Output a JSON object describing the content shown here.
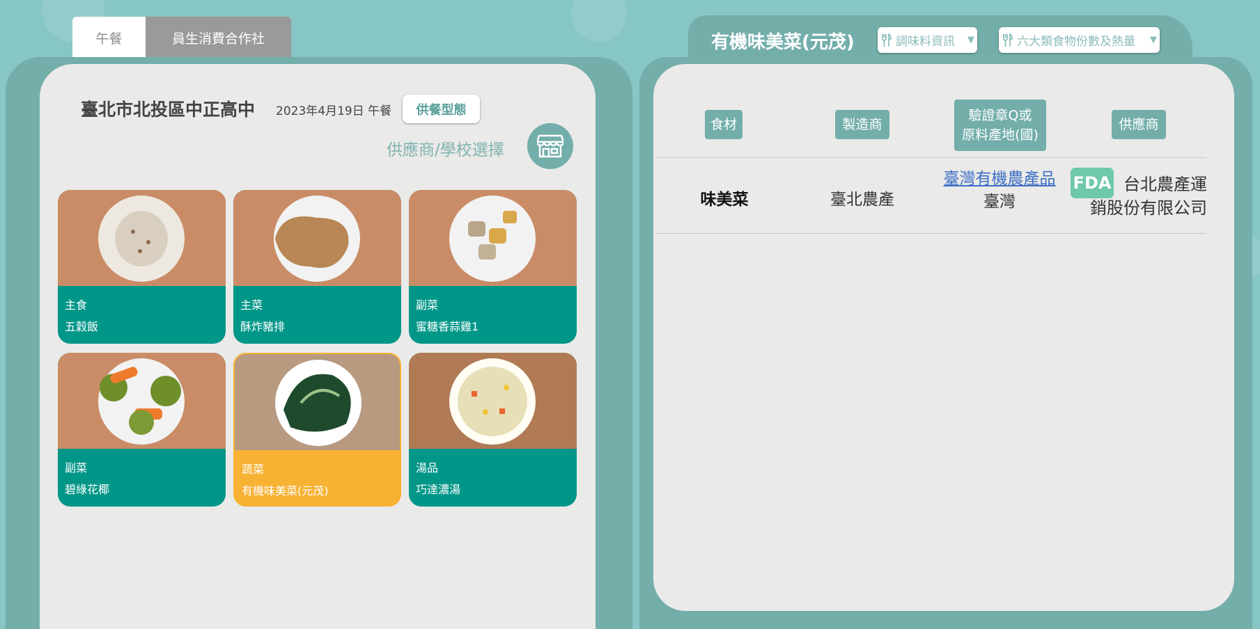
{
  "tabs": {
    "lunch": "午餐",
    "coop": "員生消費合作社"
  },
  "school": {
    "name": "臺北市北投區中正高中",
    "date_meal": "2023年4月19日 午餐",
    "supply_button": "供餐型態",
    "chooser_label": "供應商/學校選擇",
    "chooser_icon": "store-icon"
  },
  "dishes": [
    {
      "category": "主食",
      "name": "五穀飯",
      "plate": "rice",
      "selected": false
    },
    {
      "category": "主菜",
      "name": "酥炸豬排",
      "plate": "pork",
      "selected": false
    },
    {
      "category": "副菜",
      "name": "蜜糖香蒜雞1",
      "plate": "chicken",
      "selected": false
    },
    {
      "category": "副菜",
      "name": "碧綠花椰",
      "plate": "broccoli",
      "selected": false
    },
    {
      "category": "蔬菜",
      "name": "有機味美菜(元茂)",
      "plate": "greens",
      "selected": true
    },
    {
      "category": "湯品",
      "name": "巧達濃湯",
      "plate": "soup",
      "selected": false
    }
  ],
  "detail": {
    "title": "有機味美菜(元茂)",
    "dropdown_seasoning": "調味料資訊",
    "dropdown_nutrition": "六大類食物份數及熱量",
    "dropdown_icon": "utensils-icon",
    "headers": {
      "food": "食材",
      "maker": "製造商",
      "cert_line1": "驗證章Q或",
      "cert_line2": "原料產地(國)",
      "supplier": "供應商"
    },
    "row": {
      "food": "味美菜",
      "maker": "臺北農產",
      "cert_link": "臺灣有機農產品",
      "origin": "臺灣",
      "fda_badge": "FDA",
      "supplier_line1": "台北農產運",
      "supplier_line2": "銷股份有限公司"
    }
  },
  "colors": {
    "background": "#86c6c4",
    "frame": "#73aeab",
    "card": "#eaeae8",
    "dish_caption": "#009688",
    "dish_selected": "#f7b133",
    "link": "#3d6fc6",
    "fda": "#6fc9a9"
  }
}
